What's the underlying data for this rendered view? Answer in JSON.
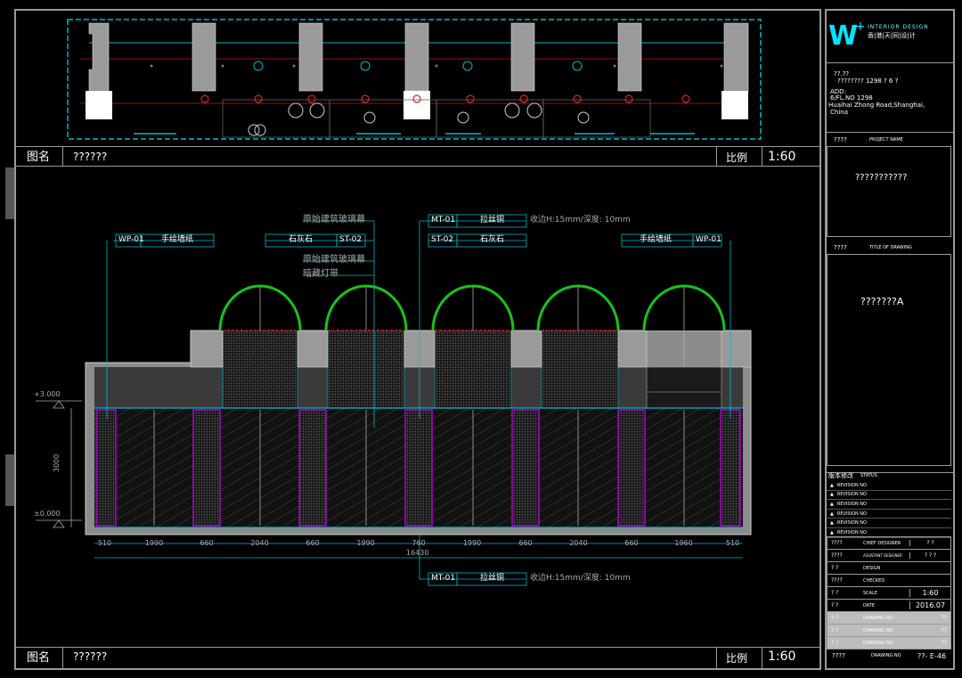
{
  "top_panel": {
    "name_label": "图名",
    "name_value": "??????",
    "scale_label": "比例",
    "scale_value": "1:60"
  },
  "bottom_panel": {
    "name_label": "图名",
    "name_value": "??????",
    "scale_label": "比例",
    "scale_value": "1:60"
  },
  "elevation": {
    "callouts": {
      "wp01_left_code": "WP-01",
      "wp01_left_name": "手绘墙纸",
      "st02_left_name": "石灰石",
      "st02_left_code": "ST-02",
      "mt01_top_code": "MT-01",
      "mt01_top_name": "拉丝铜",
      "mt01_top_note": "收边H:15mm/深度: 10mm",
      "st02_right_code": "ST-02",
      "st02_right_name": "石灰石",
      "wp01_right_name": "手绘墙纸",
      "wp01_right_code": "WP-01",
      "glass1": "原始建筑玻璃幕",
      "glass2": "原始建筑玻璃幕",
      "led": "暗藏灯带",
      "mt01_bottom_code": "MT-01",
      "mt01_bottom_name": "拉丝铜",
      "mt01_bottom_note": "收边H:15mm/深度: 10mm"
    },
    "levels": {
      "top": "+3.000",
      "bottom": "±0.000",
      "height": "3000"
    },
    "dims": [
      "510",
      "1990",
      "660",
      "2040",
      "660",
      "1990",
      "760",
      "1990",
      "660",
      "2040",
      "660",
      "1960",
      "510"
    ],
    "total": "16430"
  },
  "title_block": {
    "logo_text": "INTERIOR DESIGN",
    "logo_cn": "香|港|天|同|设|计",
    "address_line1": "??.??",
    "address_line2": "???????? 1298 ? 6 ?",
    "address_line3": "ADD:",
    "address_line4": "6/FL.NO 1298",
    "address_line5": "Huaihai Zhong Road,Shanghai,",
    "address_line6": "China",
    "project_label_cn": "????",
    "project_label_en": "PROJECT NAME",
    "project_value": "???????????",
    "drawing_label_cn": "????",
    "drawing_label_en": "TITLE OF DRAWING",
    "drawing_value": "???????A",
    "revision_label_cn": "版本修改",
    "revision_label_en": "STATUS",
    "revisions": [
      "REVISION NO",
      "REVISION NO",
      "REVISION NO",
      "REVISION NO",
      "REVISION NO",
      "REVISION NO"
    ],
    "rows": [
      {
        "cn": "????",
        "en": "CHIEF DESIGNER",
        "val": "?   ?"
      },
      {
        "cn": "????",
        "en": "ASSISTANT DESIGNER",
        "val": "? ? ?"
      },
      {
        "cn": "?   ?",
        "en": "DESIGN",
        "val": ""
      },
      {
        "cn": "????",
        "en": "CHECKED",
        "val": ""
      },
      {
        "cn": "?   ?",
        "en": "SCALE",
        "val": "1:60"
      },
      {
        "cn": "?   ?",
        "en": "DATE",
        "val": "2016.07"
      },
      {
        "cn": "?   ?",
        "en": "DRAWING NO",
        "val": "??"
      },
      {
        "cn": "?   ?",
        "en": "DRAWING NO",
        "val": "??"
      },
      {
        "cn": "?   ?",
        "en": "DRAWING NO",
        "val": "??"
      }
    ],
    "sheet_label_cn": "????",
    "sheet_label_en": "DRAWING NO",
    "sheet_value": "??- E-46"
  },
  "colors": {
    "frame": "#9a9a9a",
    "cyan": "#00e5ff",
    "green": "#19c219",
    "magenta": "#b000c8",
    "red": "#e02020",
    "gray": "#8a8a8a"
  }
}
